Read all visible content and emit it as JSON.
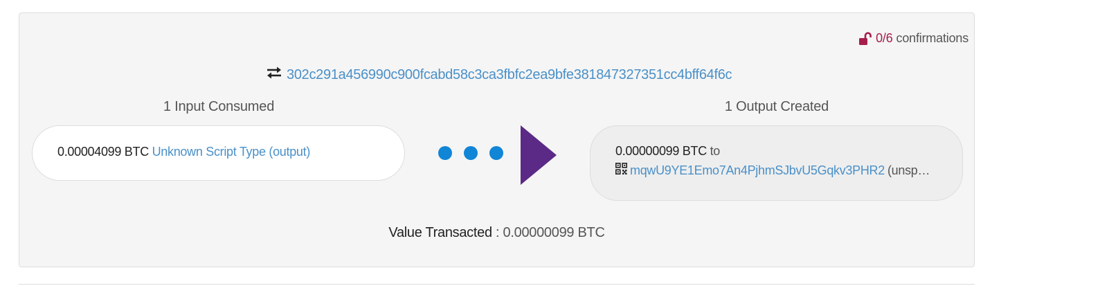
{
  "transaction": {
    "confirmations": "0/6",
    "confirmations_label": "confirmations",
    "txid": "302c291a456990c900fcabd58c3ca3fbfc2ea9bfe381847327351cc4bff64f6c"
  },
  "inputs": {
    "title": "1 Input Consumed",
    "items": [
      {
        "amount": "0.00004099 BTC",
        "script_type": "Unknown Script Type",
        "output_link": "(output)"
      }
    ]
  },
  "outputs": {
    "title": "1 Output Created",
    "items": [
      {
        "amount": "0.00000099 BTC",
        "to": "to",
        "address": "mqwU9YE1Emo7An4PjhmSJbvU5Gqkv3PHR2",
        "status": "(unsp…"
      }
    ]
  },
  "summary": {
    "value_label": "Value Transacted",
    "value": ": 0.00000099 BTC"
  },
  "colors": {
    "link": "#4a90c8",
    "dots": "#1185d6",
    "arrow": "#5b2a86",
    "lock": "#a51e4a"
  }
}
